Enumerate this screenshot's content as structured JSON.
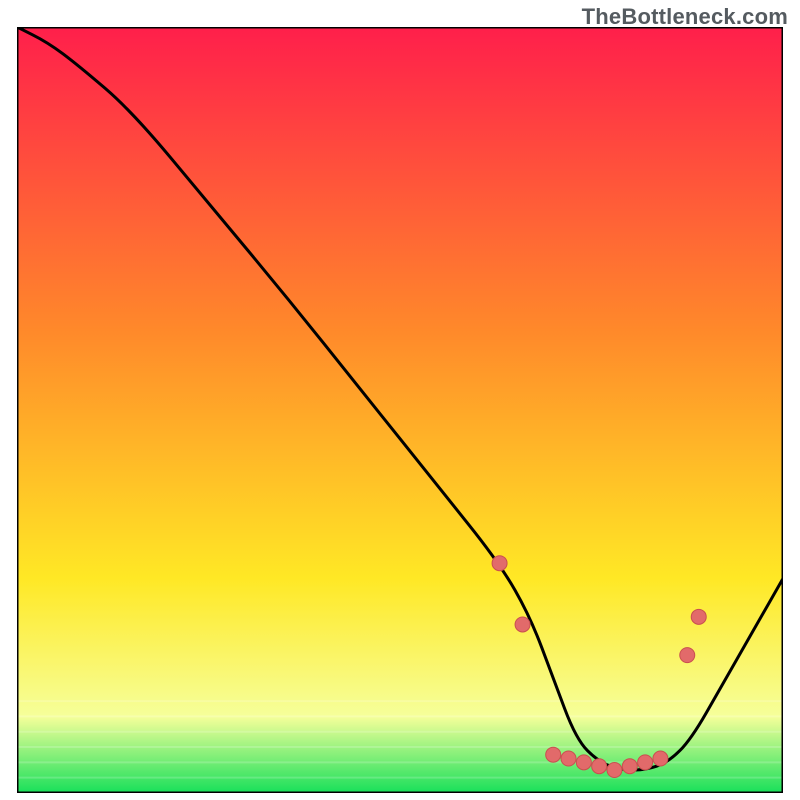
{
  "watermark": "TheBottleneck.com",
  "colors": {
    "gradient_top": "#ff1f4b",
    "gradient_mid1": "#ff8a2a",
    "gradient_mid2": "#ffe825",
    "gradient_band": "#f6ff9a",
    "gradient_bottom": "#18e05a",
    "curve": "#000000",
    "marker_fill": "#e26a6a",
    "marker_stroke": "#c94f4f",
    "border": "#000000"
  },
  "chart_data": {
    "type": "line",
    "title": "",
    "xlabel": "",
    "ylabel": "",
    "xlim": [
      0,
      100
    ],
    "ylim": [
      0,
      100
    ],
    "grid": false,
    "legend": null,
    "series": [
      {
        "name": "curve",
        "x": [
          0,
          4,
          8,
          15,
          25,
          35,
          45,
          55,
          63,
          67,
          70,
          73,
          76,
          79,
          82,
          85,
          88,
          92,
          96,
          100
        ],
        "y": [
          100,
          98,
          95,
          89,
          77,
          65,
          52.5,
          40,
          30,
          23,
          15,
          7,
          4,
          3,
          3,
          4,
          7,
          14,
          21,
          28
        ]
      }
    ],
    "markers": {
      "name": "highlight-points",
      "x": [
        63,
        67,
        70,
        73,
        76,
        79,
        82,
        85,
        88,
        89
      ],
      "y": [
        30,
        23,
        5,
        4,
        3,
        3,
        4,
        7,
        21,
        23
      ]
    },
    "marker_clusters_note": "Markers trace the valley floor and both valley walls near the minimum."
  }
}
